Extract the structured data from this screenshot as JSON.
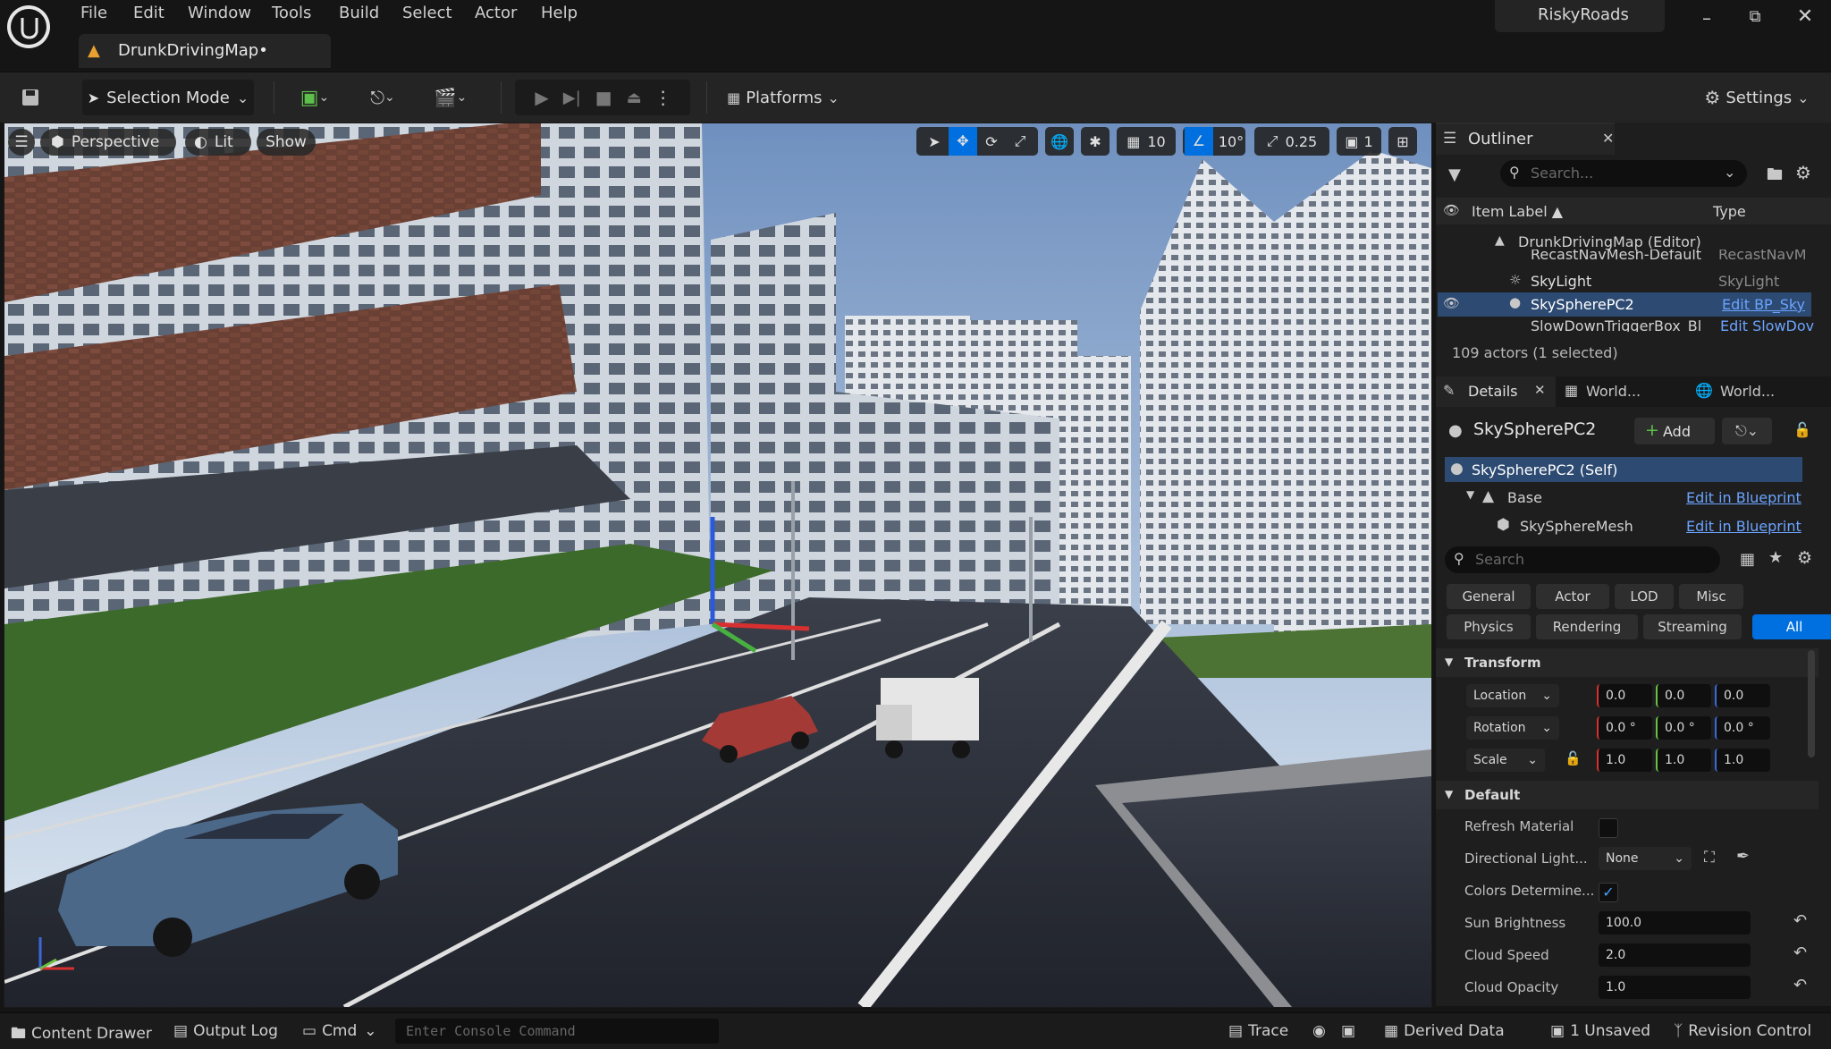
{
  "app": {
    "project_name": "RiskyRoads",
    "map_tab": "DrunkDrivingMap•"
  },
  "menu": [
    "File",
    "Edit",
    "Window",
    "Tools",
    "Build",
    "Select",
    "Actor",
    "Help"
  ],
  "toolbar": {
    "selection_mode": "Selection Mode",
    "platforms": "Platforms",
    "settings": "Settings"
  },
  "viewport": {
    "perspective": "Perspective",
    "lit": "Lit",
    "show": "Show",
    "grid_snap": "10",
    "rotation_snap": "10°",
    "scale_snap": "0.25",
    "camera_speed": "1"
  },
  "outliner": {
    "title": "Outliner",
    "search_placeholder": "Search...",
    "col_label": "Item Label ▲",
    "col_type": "Type",
    "root": "DrunkDrivingMap (Editor)",
    "items": [
      {
        "label": "RecastNavMesh-Default",
        "type": "RecastNavM"
      },
      {
        "label": "SkyLight",
        "type": "SkyLight"
      },
      {
        "label": "SkySpherePC2",
        "type": "Edit BP_Sky"
      },
      {
        "label": "SlowDownTriggerBox_Bl",
        "type": "Edit SlowDov"
      }
    ],
    "status": "109 actors (1 selected)"
  },
  "details": {
    "tabs": [
      "Details",
      "World...",
      "World..."
    ],
    "object_name": "SkySpherePC2",
    "add_label": "Add",
    "components": [
      {
        "label": "SkySpherePC2 (Self)",
        "link": ""
      },
      {
        "label": "Base",
        "link": "Edit in Blueprint"
      },
      {
        "label": "SkySphereMesh",
        "link": "Edit in Blueprint"
      }
    ],
    "search_placeholder": "Search",
    "filters_row1": [
      "General",
      "Actor",
      "LOD",
      "Misc"
    ],
    "filters_row2": [
      "Physics",
      "Rendering",
      "Streaming",
      "All"
    ],
    "transform": {
      "title": "Transform",
      "location": {
        "label": "Location",
        "x": "0.0",
        "y": "0.0",
        "z": "0.0"
      },
      "rotation": {
        "label": "Rotation",
        "x": "0.0 °",
        "y": "0.0 °",
        "z": "0.0 °"
      },
      "scale": {
        "label": "Scale",
        "x": "1.0",
        "y": "1.0",
        "z": "1.0"
      }
    },
    "default": {
      "title": "Default",
      "refresh_material": "Refresh Material",
      "directional_light": "Directional Light...",
      "directional_light_value": "None",
      "colors_determine": "Colors Determine...",
      "sun_brightness": "Sun Brightness",
      "sun_brightness_value": "100.0",
      "cloud_speed": "Cloud Speed",
      "cloud_speed_value": "2.0",
      "cloud_opacity": "Cloud Opacity",
      "cloud_opacity_value": "1.0"
    }
  },
  "statusbar": {
    "content_drawer": "Content Drawer",
    "output_log": "Output Log",
    "cmd": "Cmd",
    "console_placeholder": "Enter Console Command",
    "trace": "Trace",
    "derived_data": "Derived Data",
    "unsaved": "1 Unsaved",
    "revision_control": "Revision Control"
  },
  "colors": {
    "accent": "#0070e0",
    "selected_row": "#2d4a72",
    "axis_x": "#d83030",
    "axis_y": "#6ac040",
    "axis_z": "#3a6ad8"
  }
}
